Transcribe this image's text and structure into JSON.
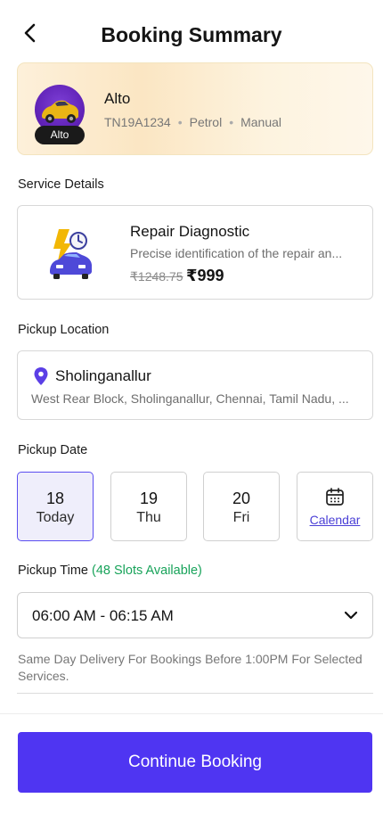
{
  "header": {
    "title": "Booking Summary"
  },
  "car": {
    "name": "Alto",
    "badge": "Alto",
    "registration": "TN19A1234",
    "fuel": "Petrol",
    "transmission": "Manual",
    "dot": "•"
  },
  "service": {
    "section_label": "Service Details",
    "name": "Repair Diagnostic",
    "description": "Precise identification of the repair an...",
    "original_price": "₹1248.75",
    "price": "₹999"
  },
  "pickup_location": {
    "section_label": "Pickup Location",
    "name": "Sholinganallur",
    "address": "West Rear Block, Sholinganallur, Chennai, Tamil Nadu, ..."
  },
  "pickup_date": {
    "section_label": "Pickup Date",
    "dates": [
      {
        "day_num": "18",
        "day_label": "Today",
        "selected": true
      },
      {
        "day_num": "19",
        "day_label": "Thu",
        "selected": false
      },
      {
        "day_num": "20",
        "day_label": "Fri",
        "selected": false
      }
    ],
    "calendar_label": "Calendar"
  },
  "pickup_time": {
    "section_label": "Pickup Time",
    "slots_label": "(48 Slots Available)",
    "selected_slot": "06:00 AM - 06:15 AM",
    "note": "Same Day Delivery For Bookings Before 1:00PM For Selected Services."
  },
  "cta": {
    "label": "Continue Booking"
  },
  "colors": {
    "accent": "#4f35f2",
    "selected_date_bg": "#efeefb",
    "slots_green": "#18a35a",
    "car_card_bg": "#fbe6c3"
  },
  "icons": [
    "back-arrow-icon",
    "car-icon",
    "repair-diagnostic-icon",
    "location-pin-icon",
    "calendar-icon",
    "chevron-down-icon"
  ]
}
